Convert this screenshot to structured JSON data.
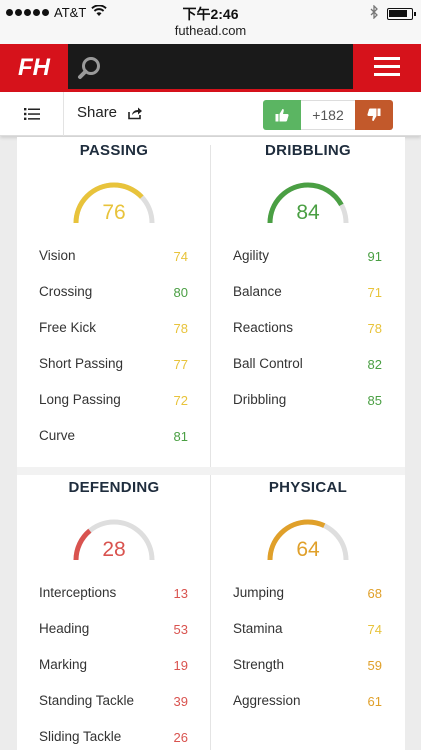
{
  "status_bar": {
    "carrier": "AT&T",
    "time": "下午2:46",
    "url": "futhead.com"
  },
  "nav": {
    "logo_text": "FH"
  },
  "toolbar": {
    "share_label": "Share",
    "vote_count": "+182"
  },
  "colors": {
    "yellow": "#e8c33b",
    "green": "#4a9f43",
    "red": "#d9534f",
    "orange": "#e0a02a",
    "brand": "#d6121b"
  },
  "sections": [
    {
      "title": "PASSING",
      "value": "76",
      "color": "#e8c33b",
      "stats": [
        {
          "name": "Vision",
          "value": "74",
          "color": "#e8c33b"
        },
        {
          "name": "Crossing",
          "value": "80",
          "color": "#4a9f43"
        },
        {
          "name": "Free Kick",
          "value": "78",
          "color": "#e8c33b"
        },
        {
          "name": "Short Passing",
          "value": "77",
          "color": "#e8c33b"
        },
        {
          "name": "Long Passing",
          "value": "72",
          "color": "#e8c33b"
        },
        {
          "name": "Curve",
          "value": "81",
          "color": "#4a9f43"
        }
      ]
    },
    {
      "title": "DRIBBLING",
      "value": "84",
      "color": "#4a9f43",
      "stats": [
        {
          "name": "Agility",
          "value": "91",
          "color": "#4a9f43"
        },
        {
          "name": "Balance",
          "value": "71",
          "color": "#e8c33b"
        },
        {
          "name": "Reactions",
          "value": "78",
          "color": "#e8c33b"
        },
        {
          "name": "Ball Control",
          "value": "82",
          "color": "#4a9f43"
        },
        {
          "name": "Dribbling",
          "value": "85",
          "color": "#4a9f43"
        }
      ]
    },
    {
      "title": "DEFENDING",
      "value": "28",
      "color": "#d9534f",
      "stats": [
        {
          "name": "Interceptions",
          "value": "13",
          "color": "#d9534f"
        },
        {
          "name": "Heading",
          "value": "53",
          "color": "#d9534f"
        },
        {
          "name": "Marking",
          "value": "19",
          "color": "#d9534f"
        },
        {
          "name": "Standing Tackle",
          "value": "39",
          "color": "#d9534f"
        },
        {
          "name": "Sliding Tackle",
          "value": "26",
          "color": "#d9534f"
        }
      ]
    },
    {
      "title": "PHYSICAL",
      "value": "64",
      "color": "#e0a02a",
      "stats": [
        {
          "name": "Jumping",
          "value": "68",
          "color": "#e0a02a"
        },
        {
          "name": "Stamina",
          "value": "74",
          "color": "#e8c33b"
        },
        {
          "name": "Strength",
          "value": "59",
          "color": "#e0a02a"
        },
        {
          "name": "Aggression",
          "value": "61",
          "color": "#e0a02a"
        }
      ]
    }
  ]
}
